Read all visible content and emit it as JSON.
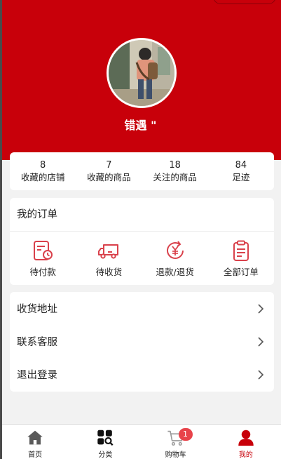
{
  "profile": {
    "username": "错遇 \""
  },
  "stats": [
    {
      "count": "8",
      "label": "收藏的店铺"
    },
    {
      "count": "7",
      "label": "收藏的商品"
    },
    {
      "count": "18",
      "label": "关注的商品"
    },
    {
      "count": "84",
      "label": "足迹"
    }
  ],
  "orders": {
    "title": "我的订单",
    "items": [
      {
        "label": "待付款",
        "icon": "pending-payment-icon"
      },
      {
        "label": "待收货",
        "icon": "delivery-truck-icon"
      },
      {
        "label": "退款/退货",
        "icon": "refund-icon"
      },
      {
        "label": "全部订单",
        "icon": "clipboard-icon"
      }
    ]
  },
  "menu": {
    "items": [
      {
        "label": "收货地址"
      },
      {
        "label": "联系客服"
      },
      {
        "label": "退出登录"
      }
    ]
  },
  "tabbar": {
    "items": [
      {
        "label": "首页",
        "icon": "home-icon"
      },
      {
        "label": "分类",
        "icon": "category-icon"
      },
      {
        "label": "购物车",
        "icon": "cart-icon",
        "badge": "1"
      },
      {
        "label": "我的",
        "icon": "person-icon",
        "active": true
      }
    ]
  },
  "colors": {
    "brand": "#c8000a",
    "order_icon": "#d9414b",
    "badge": "#e8434a"
  }
}
